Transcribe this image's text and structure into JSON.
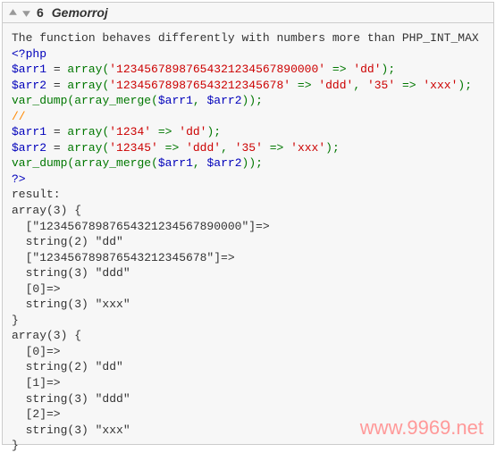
{
  "header": {
    "vote_count": "6",
    "author": "Gemorroj"
  },
  "description": "The function behaves differently with numbers more than PHP_INT_MAX",
  "code": {
    "php_open": "<?php",
    "l1_var": "$arr1",
    "l1_eq": " = ",
    "l1_fn": "array",
    "l1_p1": "(",
    "l1_s1": "'12345678987654321234567890000'",
    "l1_ar": " => ",
    "l1_s2": "'dd'",
    "l1_p2": ");",
    "l2_var": "$arr2",
    "l2_fn": "array",
    "l2_p1": "(",
    "l2_s1": "'123456789876543212345678'",
    "l2_ar": " => ",
    "l2_s2": "'ddd'",
    "l2_c": ", ",
    "l2_s3": "'35'",
    "l2_ar2": " => ",
    "l2_s4": "'xxx'",
    "l2_p2": ");",
    "l3_fn1": "var_dump",
    "l3_p1": "(",
    "l3_fn2": "array_merge",
    "l3_p2": "(",
    "l3_v1": "$arr1",
    "l3_c": ", ",
    "l3_v2": "$arr2",
    "l3_p3": "));",
    "comment": "//",
    "l4_var": "$arr1",
    "l4_fn": "array",
    "l4_p1": "(",
    "l4_s1": "'1234'",
    "l4_ar": " => ",
    "l4_s2": "'dd'",
    "l4_p2": ");",
    "l5_var": "$arr2",
    "l5_fn": "array",
    "l5_p1": "(",
    "l5_s1": "'12345'",
    "l5_ar": " => ",
    "l5_s2": "'ddd'",
    "l5_c": ", ",
    "l5_s3": "'35'",
    "l5_ar2": " => ",
    "l5_s4": "'xxx'",
    "l5_p2": ");",
    "l6_fn1": "var_dump",
    "l6_p1": "(",
    "l6_fn2": "array_merge",
    "l6_p2": "(",
    "l6_v1": "$arr1",
    "l6_c": ", ",
    "l6_v2": "$arr2",
    "l6_p3": "));",
    "php_close": "?>"
  },
  "result": {
    "label": "result:",
    "r01": "array(3) {",
    "r02": "  [\"12345678987654321234567890000\"]=>",
    "r03": "  string(2) \"dd\"",
    "r04": "  [\"123456789876543212345678\"]=>",
    "r05": "  string(3) \"ddd\"",
    "r06": "  [0]=>",
    "r07": "  string(3) \"xxx\"",
    "r08": "}",
    "r09": "array(3) {",
    "r10": "  [0]=>",
    "r11": "  string(2) \"dd\"",
    "r12": "  [1]=>",
    "r13": "  string(3) \"ddd\"",
    "r14": "  [2]=>",
    "r15": "  string(3) \"xxx\"",
    "r16": "}"
  },
  "watermark": "www.9969.net"
}
